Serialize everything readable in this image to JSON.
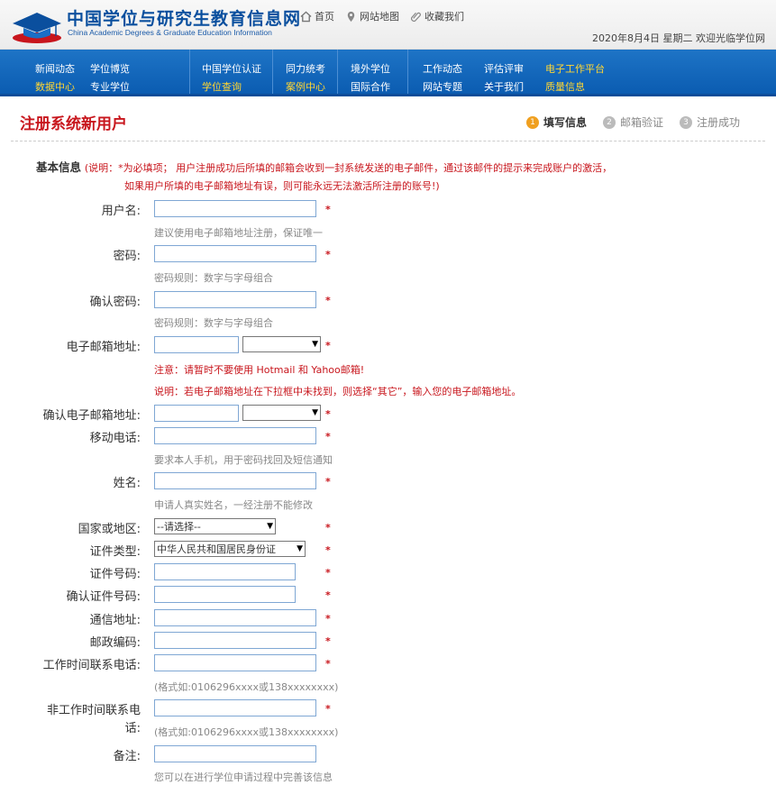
{
  "header": {
    "title": "中国学位与研究生教育信息网",
    "subtitle": "China Academic Degrees & Graduate Education Information",
    "links": [
      "首页",
      "网站地图",
      "收藏我们"
    ],
    "date": "2020年8月4日  星期二  欢迎光临学位网"
  },
  "nav": {
    "row1": [
      "新闻动态",
      "学位博览",
      "中国学位认证",
      "同力统考",
      "境外学位",
      "工作动态",
      "评估评审",
      "电子工作平台"
    ],
    "row2": [
      "数据中心",
      "专业学位",
      "学位查询",
      "案例中心",
      "国际合作",
      "网站专题",
      "关于我们",
      "质量信息"
    ]
  },
  "page": {
    "title": "注册系统新用户",
    "steps": [
      {
        "num": "1",
        "label": "填写信息"
      },
      {
        "num": "2",
        "label": "邮箱验证"
      },
      {
        "num": "3",
        "label": "注册成功"
      }
    ]
  },
  "form": {
    "section_title": "基本信息",
    "section_note": "(说明：*为必填项；  用户注册成功后所填的邮箱会收到一封系统发送的电子邮件，通过该邮件的提示来完成账户的激活，",
    "section_note2": "如果用户所填的电子邮箱地址有误，则可能永远无法激活所注册的账号!)",
    "required_mark": "*",
    "username_label": "用户名:",
    "username_hint": "建议使用电子邮箱地址注册，保证唯一",
    "password_label": "密码:",
    "password_hint": "密码规则：数字与字母组合",
    "confirm_password_label": "确认密码:",
    "confirm_password_hint": "密码规则：数字与字母组合",
    "email_label": "电子邮箱地址:",
    "email_warn1": "注意：请暂时不要使用 Hotmail 和 Yahoo邮箱!",
    "email_warn2": "说明：若电子邮箱地址在下拉框中未找到，则选择“其它”，输入您的电子邮箱地址。",
    "confirm_email_label": "确认电子邮箱地址:",
    "mobile_label": "移动电话:",
    "mobile_hint": "要求本人手机，用于密码找回及短信通知",
    "name_label": "姓名:",
    "name_hint": "申请人真实姓名，一经注册不能修改",
    "country_label": "国家或地区:",
    "country_value": "--请选择--",
    "idtype_label": "证件类型:",
    "idtype_value": "中华人民共和国居民身份证",
    "idno_label": "证件号码:",
    "confirm_idno_label": "确认证件号码:",
    "address_label": "通信地址:",
    "postcode_label": "邮政编码:",
    "work_phone_label": "工作时间联系电话:",
    "work_phone_hint": "(格式如:0106296xxxx或138xxxxxxxx)",
    "off_phone_label1": "非工作时间联系电",
    "off_phone_label2": "话:",
    "off_phone_hint": "(格式如:0106296xxxx或138xxxxxxxx)",
    "remark_label": "备注:",
    "remark_hint": "您可以在进行学位申请过程中完善该信息"
  }
}
